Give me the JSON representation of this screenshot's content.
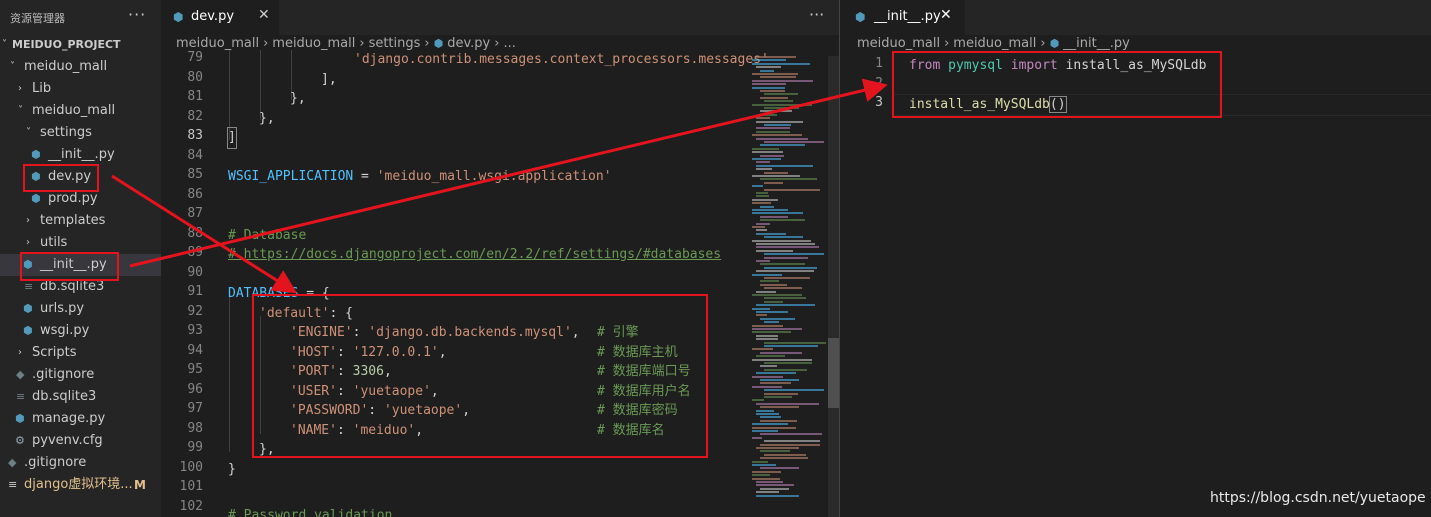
{
  "explorer": {
    "title": "资源管理器",
    "more": "···",
    "project": "MEIDUO_PROJECT",
    "tree": [
      {
        "label": "meiduo_mall",
        "kind": "folder-open"
      },
      {
        "label": "Lib",
        "kind": "folder"
      },
      {
        "label": "meiduo_mall",
        "kind": "folder-open"
      },
      {
        "label": "settings",
        "kind": "folder-open"
      },
      {
        "label": "__init__.py",
        "kind": "py"
      },
      {
        "label": "dev.py",
        "kind": "py"
      },
      {
        "label": "prod.py",
        "kind": "py"
      },
      {
        "label": "templates",
        "kind": "folder"
      },
      {
        "label": "utils",
        "kind": "folder"
      },
      {
        "label": "__init__.py",
        "kind": "py"
      },
      {
        "label": "db.sqlite3",
        "kind": "db"
      },
      {
        "label": "urls.py",
        "kind": "py"
      },
      {
        "label": "wsgi.py",
        "kind": "py"
      },
      {
        "label": "Scripts",
        "kind": "folder"
      },
      {
        "label": ".gitignore",
        "kind": "git"
      },
      {
        "label": "db.sqlite3",
        "kind": "db"
      },
      {
        "label": "manage.py",
        "kind": "py"
      },
      {
        "label": "pyvenv.cfg",
        "kind": "cfg"
      },
      {
        "label": ".gitignore",
        "kind": "git"
      },
      {
        "label": "django虚拟环境...",
        "kind": "md",
        "badge": "M"
      }
    ]
  },
  "left_editor": {
    "tab": {
      "label": "dev.py",
      "close": "✕"
    },
    "more": "···",
    "breadcrumb": [
      "meiduo_mall",
      "meiduo_mall",
      "settings",
      "dev.py",
      "..."
    ],
    "lines": [
      {
        "n": "79",
        "text": "'django.contrib.messages.context_processors.messages'"
      },
      {
        "n": "80",
        "text": "],"
      },
      {
        "n": "81",
        "text": "},"
      },
      {
        "n": "82",
        "text": "},"
      },
      {
        "n": "83",
        "text": "]"
      },
      {
        "n": "84",
        "text": ""
      },
      {
        "n": "85",
        "text": "WSGI_APPLICATION = 'meiduo_mall.wsgi.application'"
      },
      {
        "n": "86",
        "text": ""
      },
      {
        "n": "87",
        "text": ""
      },
      {
        "n": "88",
        "text": "# Database"
      },
      {
        "n": "89",
        "text": "# https://docs.djangoproject.com/en/2.2/ref/settings/#databases"
      },
      {
        "n": "90",
        "text": ""
      },
      {
        "n": "91",
        "text": "DATABASES = {"
      },
      {
        "n": "92",
        "text": "'default': {"
      },
      {
        "n": "93",
        "key": "'ENGINE'",
        "value": "'django.db.backends.mysql'",
        "comment": "# 引擎"
      },
      {
        "n": "94",
        "key": "'HOST'",
        "value": "'127.0.0.1'",
        "comment": "# 数据库主机"
      },
      {
        "n": "95",
        "key": "'PORT'",
        "value": "3306",
        "comment": "# 数据库端口号"
      },
      {
        "n": "96",
        "key": "'USER'",
        "value": "'yuetaope'",
        "comment": "# 数据库用户名"
      },
      {
        "n": "97",
        "key": "'PASSWORD'",
        "value": "'yuetaope'",
        "comment": "# 数据库密码"
      },
      {
        "n": "98",
        "key": "'NAME'",
        "value": "'meiduo'",
        "comment": "# 数据库名"
      },
      {
        "n": "99",
        "text": "},"
      },
      {
        "n": "100",
        "text": "}"
      },
      {
        "n": "101",
        "text": ""
      },
      {
        "n": "102",
        "text": ""
      },
      {
        "n": "103",
        "text": "# Password validation"
      }
    ]
  },
  "right_editor": {
    "tab": {
      "label": "__init__.py",
      "close": "✕"
    },
    "breadcrumb": [
      "meiduo_mall",
      "meiduo_mall",
      "__init__.py"
    ],
    "lines": [
      {
        "n": "1",
        "kw_from": "from",
        "module": "pymysql",
        "kw_import": "import",
        "name": "install_as_MySQLdb"
      },
      {
        "n": "2",
        "text": ""
      },
      {
        "n": "3",
        "fn": "install_as_MySQLdb",
        "paren": "()"
      }
    ]
  },
  "watermark": "https://blog.csdn.net/yuetaope",
  "colors": {
    "annotation": "#e4141e",
    "python_icon": "#519aba",
    "background": "#1e1e1e"
  }
}
